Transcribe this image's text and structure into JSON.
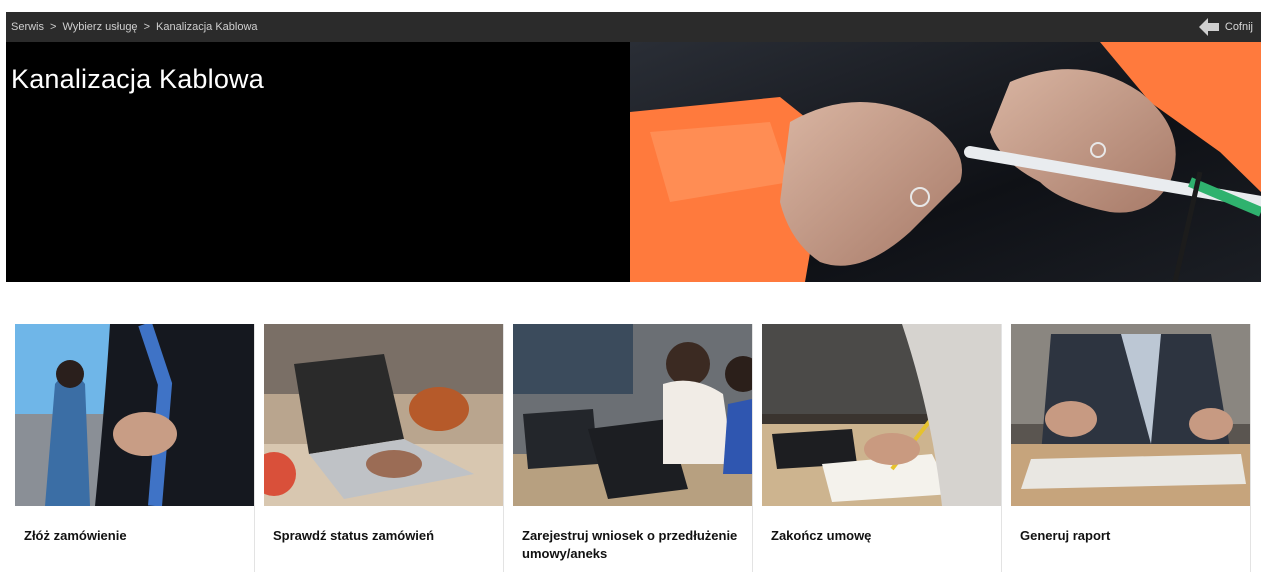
{
  "breadcrumb": {
    "items": [
      "Serwis",
      "Wybierz usługę",
      "Kanalizacja Kablowa"
    ],
    "separator": ">"
  },
  "header": {
    "back_label": "Cofnij",
    "back_icon": "arrow-left-icon"
  },
  "hero": {
    "title": "Kanalizacja Kablowa"
  },
  "cards": [
    {
      "label": "Złóż zamówienie"
    },
    {
      "label": "Sprawdź status zamówień"
    },
    {
      "label": "Zarejestruj wniosek o przedłużenie umowy/aneks"
    },
    {
      "label": "Zakończ umowę"
    },
    {
      "label": "Generuj raport"
    }
  ],
  "colors": {
    "topbar": "#2b2b2b",
    "hero_bg": "#000000",
    "accent_orange": "#ff7a3d"
  }
}
